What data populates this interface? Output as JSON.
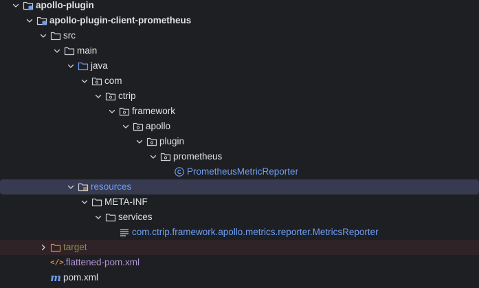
{
  "tree": {
    "rows": [
      {
        "label": "apollo-plugin",
        "level": 0,
        "expanded": true,
        "icon": "module-folder-icon",
        "bold": true
      },
      {
        "label": "apollo-plugin-client-prometheus",
        "level": 1,
        "expanded": true,
        "icon": "module-folder-icon",
        "bold": true
      },
      {
        "label": "src",
        "level": 2,
        "expanded": true,
        "icon": "folder-icon"
      },
      {
        "label": "main",
        "level": 3,
        "expanded": true,
        "icon": "folder-icon"
      },
      {
        "label": "java",
        "level": 4,
        "expanded": true,
        "icon": "source-root-folder-icon"
      },
      {
        "label": "com",
        "level": 5,
        "expanded": true,
        "icon": "package-icon"
      },
      {
        "label": "ctrip",
        "level": 6,
        "expanded": true,
        "icon": "package-icon"
      },
      {
        "label": "framework",
        "level": 7,
        "expanded": true,
        "icon": "package-icon"
      },
      {
        "label": "apollo",
        "level": 8,
        "expanded": true,
        "icon": "package-icon"
      },
      {
        "label": "plugin",
        "level": 9,
        "expanded": true,
        "icon": "package-icon"
      },
      {
        "label": "prometheus",
        "level": 10,
        "expanded": true,
        "icon": "package-icon"
      },
      {
        "label": "PrometheusMetricReporter",
        "level": 11,
        "icon": "class-icon",
        "color": "#6e9ef5"
      },
      {
        "label": "resources",
        "level": 4,
        "expanded": true,
        "icon": "resources-root-folder-icon",
        "color": "#6e9ef5",
        "selected": true
      },
      {
        "label": "META-INF",
        "level": 5,
        "expanded": true,
        "icon": "folder-icon"
      },
      {
        "label": "services",
        "level": 6,
        "expanded": true,
        "icon": "folder-icon"
      },
      {
        "label": "com.ctrip.framework.apollo.metrics.reporter.MetricsReporter",
        "level": 7,
        "icon": "text-file-icon",
        "color": "#6e9ef5"
      },
      {
        "label": "target",
        "level": 2,
        "expanded": false,
        "icon": "excluded-folder-icon",
        "color": "#8f8a56",
        "excluded": true
      },
      {
        "label": ".flattened-pom.xml",
        "level": 2,
        "icon": "xml-file-icon",
        "color": "#b493d6"
      },
      {
        "label": "pom.xml",
        "level": 2,
        "icon": "maven-icon"
      }
    ]
  },
  "colors": {
    "background": "#1e1f22",
    "text": "#dfe1e5",
    "selection": "#373a51",
    "excluded_row": "#2f2327",
    "accent_blue": "#6e9ef5",
    "excluded_text": "#8f8a56",
    "ignored_text": "#b493d6"
  }
}
